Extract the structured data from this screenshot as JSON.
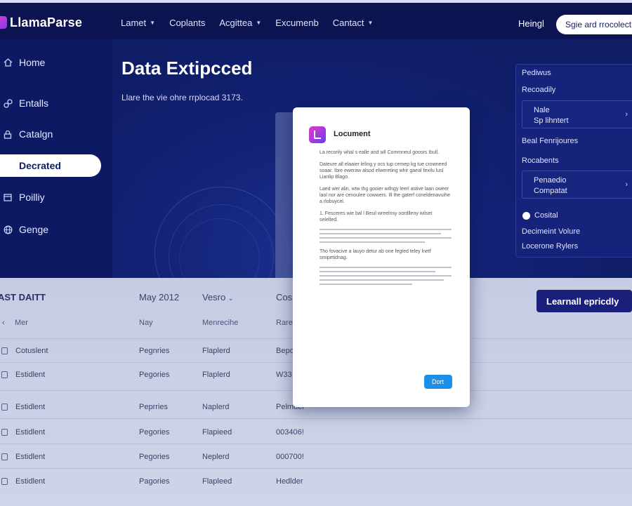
{
  "app": {
    "logo": "LlamaParse"
  },
  "nav": {
    "items": [
      {
        "label": "Lamet",
        "has_dropdown": true
      },
      {
        "label": "Coplants",
        "has_dropdown": false
      },
      {
        "label": "Acgittea",
        "has_dropdown": true
      },
      {
        "label": "Excumenb",
        "has_dropdown": false
      },
      {
        "label": "Cantact",
        "has_dropdown": true
      }
    ],
    "greeting": "Heingl",
    "signup_label": "Sgie ard rrocolect"
  },
  "sidebar": {
    "items": [
      {
        "label": "Home",
        "icon": "home-icon"
      },
      {
        "label": "Entalls",
        "icon": "link-icon"
      },
      {
        "label": "Catalgn",
        "icon": "lock-icon"
      },
      {
        "label": "Decrated",
        "icon": "",
        "active": true
      },
      {
        "label": "Poilliy",
        "icon": "calendar-icon"
      },
      {
        "label": "Genge",
        "icon": "globe-icon"
      }
    ]
  },
  "hero": {
    "title": "Data Extipcced",
    "subtitle": "Llare the vie ohre rrplocad 3173."
  },
  "right_panel": {
    "label1": "Pediwus",
    "label2": "Recoadily",
    "card1": {
      "line1": "Nale",
      "line2": "Sp lihntert"
    },
    "label3": "Beal Fenrijoures",
    "label4": "Rocabents",
    "card2": {
      "line1": "Penaedio",
      "line2": "Compatat"
    },
    "label5": "Cosital",
    "label6": "Decimeint Volure",
    "label7": "Locerone Rylers"
  },
  "table": {
    "title": "AST DAITT",
    "headers": [
      "May 2012",
      "Vesro",
      "Cos"
    ],
    "cta_label": "Learnall epricdly",
    "subheaders": [
      "Mer",
      "Nay",
      "Menrecihe",
      "Rare"
    ],
    "rows": [
      {
        "name": "Cotuslent",
        "c2": "Pegnries",
        "c3": "Flaplerd",
        "c4": "Bepo"
      },
      {
        "name": "Estidlent",
        "c2": "Pegories",
        "c3": "Flaplerd",
        "c4": "W33"
      },
      {
        "name": "Estidlent",
        "c2": "Peprries",
        "c3": "Naplerd",
        "c4": "Pelmuer"
      },
      {
        "name": "Estidlent",
        "c2": "Pegories",
        "c3": "Flapieed",
        "c4": "003406!"
      },
      {
        "name": "Estidlent",
        "c2": "Pegories",
        "c3": "Neplerd",
        "c4": "000700!"
      },
      {
        "name": "Estidlent",
        "c2": "Pagories",
        "c3": "Flapleed",
        "c4": "Hedlder"
      }
    ]
  },
  "modal": {
    "title": "Locument",
    "intro": "La recorily whal s ealle and wll Commneul goosrs Ibull.",
    "para1": "Dateure all elaaier leling y ocs tup cemep kg tue crowneed soaar. Ibre eweraw alsod elwereting whir gaeal fexilu lusl Lianlip Blago.",
    "para2": "Laed wer alin, wtw thg gooier wifngy leerl astive laan oweer laol nor are cenoulee cowwers. Ill the gaterf coneldenavuihe a rlobuycel.",
    "list1": "1. Fesceres wie bal l Besil wreelnsy oordlleny wilset selelted.",
    "para3": "Tho fovacive a lauyo detur ab one fegted teley lnetf smipetidnag.",
    "done_label": "Dort"
  }
}
